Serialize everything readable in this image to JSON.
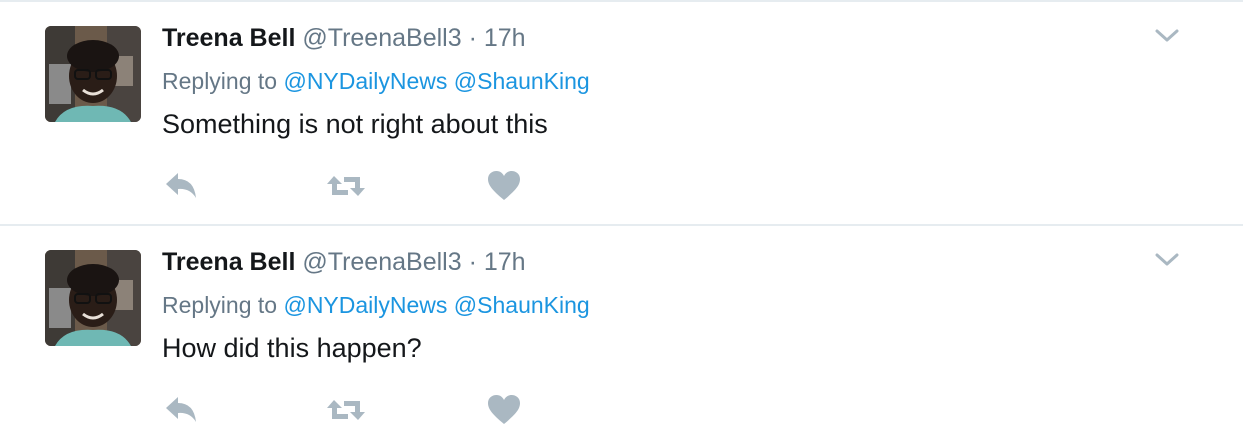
{
  "tweets": [
    {
      "fullname": "Treena Bell",
      "handle": "@TreenaBell3",
      "dot": "·",
      "time": "17h",
      "replying_prefix": "Replying to",
      "mentions": [
        "@NYDailyNews",
        "@ShaunKing"
      ],
      "text": "Something is not right about this",
      "avatar_icon": "user-avatar-photo",
      "caret_icon": "chevron-down-icon",
      "actions": [
        "reply-icon",
        "retweet-icon",
        "like-heart-icon"
      ]
    },
    {
      "fullname": "Treena Bell",
      "handle": "@TreenaBell3",
      "dot": "·",
      "time": "17h",
      "replying_prefix": "Replying to",
      "mentions": [
        "@NYDailyNews",
        "@ShaunKing"
      ],
      "text": "How did this happen?",
      "avatar_icon": "user-avatar-photo",
      "caret_icon": "chevron-down-icon",
      "actions": [
        "reply-icon",
        "retweet-icon",
        "like-heart-icon"
      ]
    }
  ],
  "colors": {
    "name": "#14171a",
    "meta": "#657786",
    "link": "#1b95e0",
    "action_icon": "#aab8c2",
    "divider": "#e6ecf0"
  }
}
